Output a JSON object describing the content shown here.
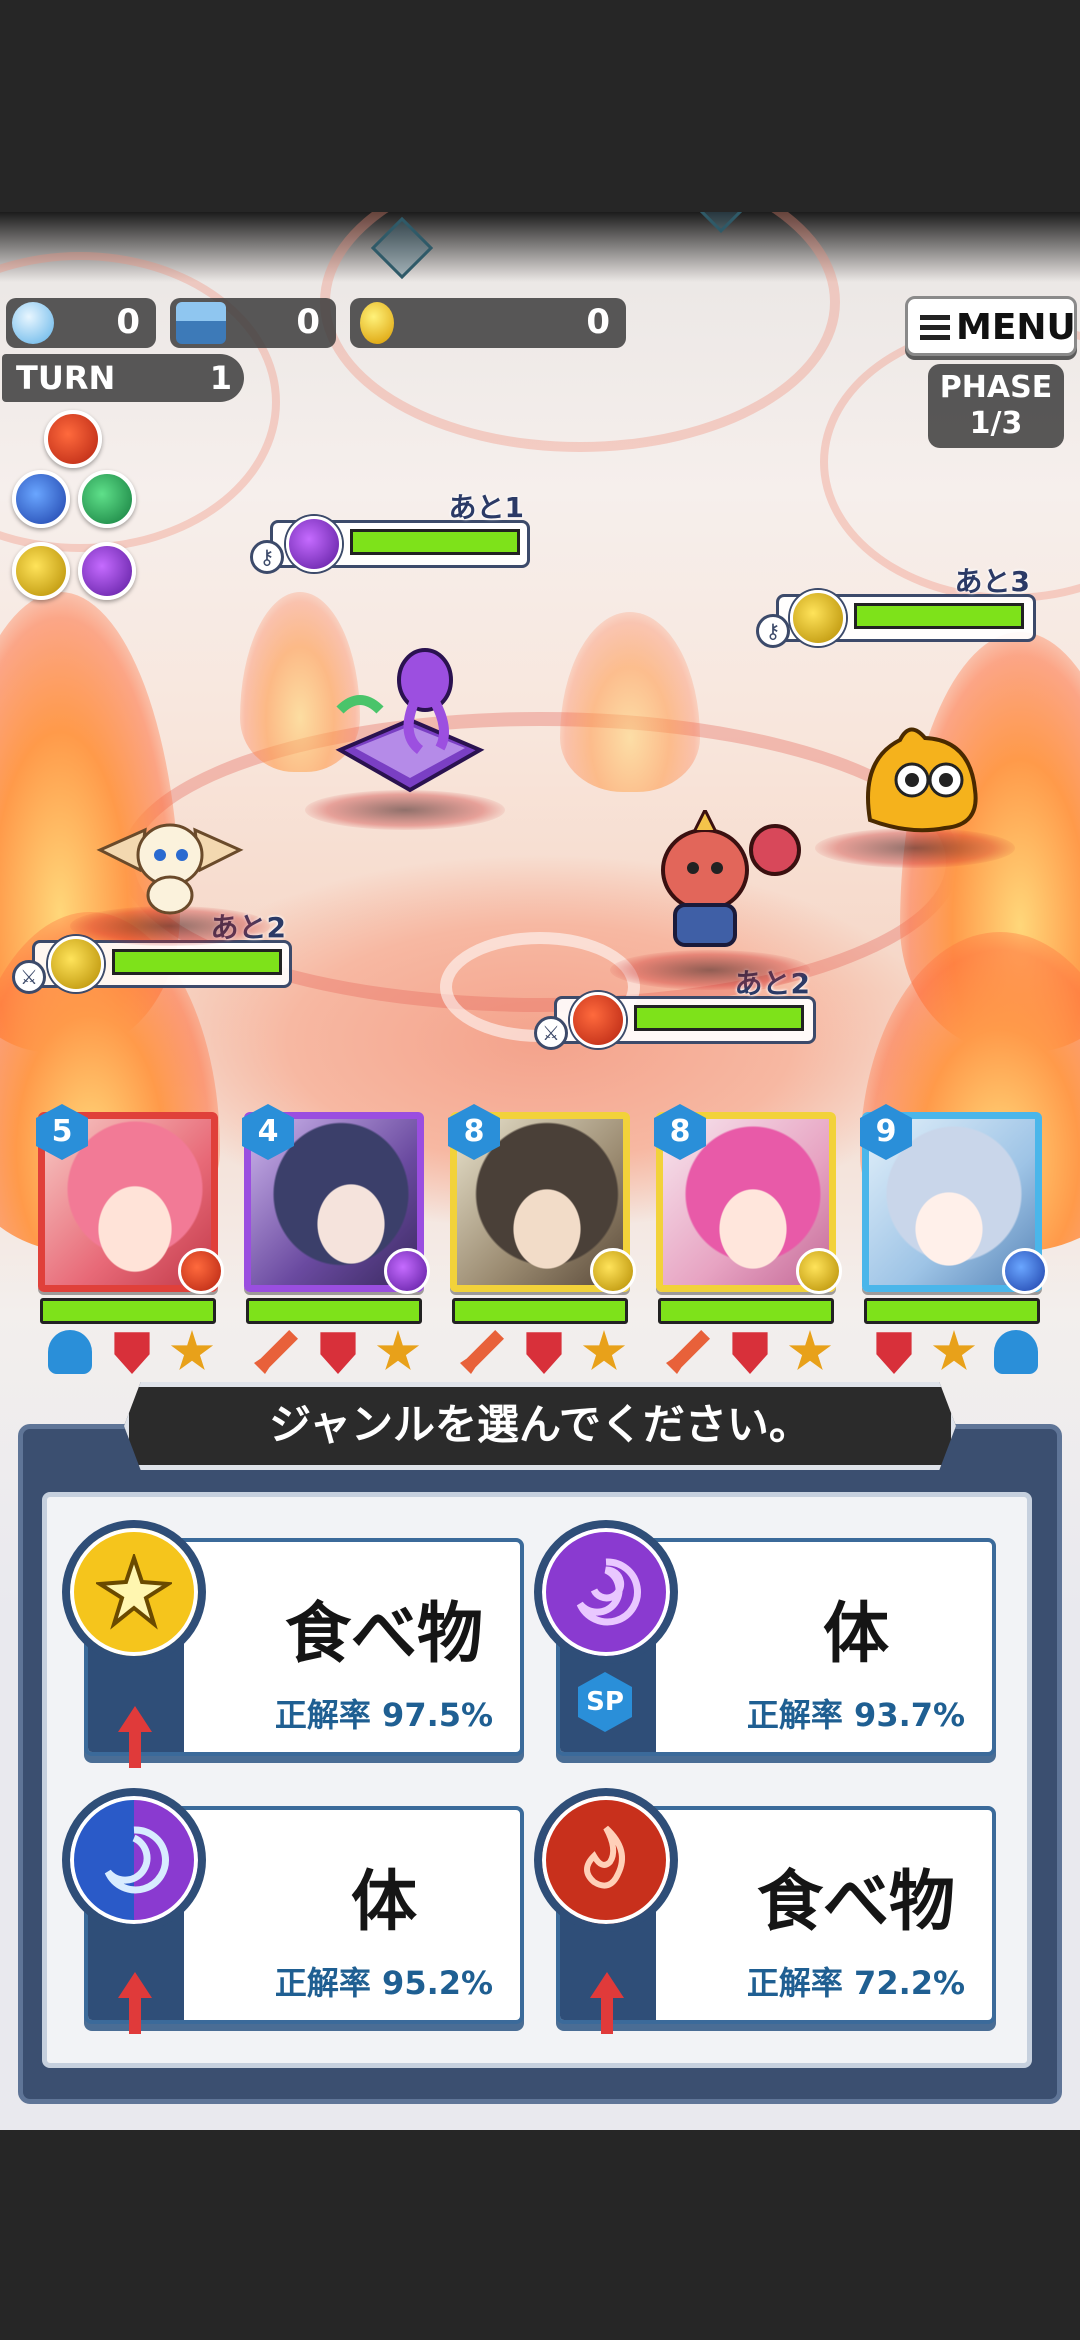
{
  "hud": {
    "counters": [
      {
        "name": "blue-orb-counter",
        "value": "0"
      },
      {
        "name": "chest-counter",
        "value": "0"
      },
      {
        "name": "coin-counter",
        "value": "0"
      }
    ],
    "turn_label": "TURN",
    "turn_value": "1",
    "menu_label": "MENU",
    "phase_label": "PHASE",
    "phase_value": "1/3"
  },
  "element_wheel": [
    "fire-icon",
    "water-icon",
    "wood-icon",
    "light-icon",
    "dark-icon"
  ],
  "enemies": [
    {
      "name": "dark-book-monster",
      "element": "dark",
      "countdown": "あと1",
      "hp": 1.0
    },
    {
      "name": "light-blob-monster",
      "element": "light",
      "countdown": "あと3",
      "hp": 1.0
    },
    {
      "name": "light-dragon-monster",
      "element": "light",
      "countdown": "あと2",
      "hp": 1.0
    },
    {
      "name": "fire-goblin-monster",
      "element": "fire",
      "countdown": "あと2",
      "hp": 1.0
    }
  ],
  "party": [
    {
      "level": "5",
      "element": "fire",
      "color": "#e0403a",
      "hp": 1.0
    },
    {
      "level": "4",
      "element": "dark",
      "color": "#9a4ee0",
      "hp": 1.0
    },
    {
      "level": "8",
      "element": "light",
      "color": "#f2d23a",
      "hp": 1.0
    },
    {
      "level": "8",
      "element": "light",
      "color": "#f2d23a",
      "hp": 1.0
    },
    {
      "level": "9",
      "element": "water",
      "color": "#4ab6ea",
      "hp": 1.0
    }
  ],
  "prompt": "ジャンルを選んでください。",
  "choices": [
    {
      "genre": "食べ物",
      "rate": "正解率 97.5%",
      "element": "light",
      "marker": "up-arrow"
    },
    {
      "genre": "体",
      "rate": "正解率 93.7%",
      "element": "dark",
      "marker": "SP"
    },
    {
      "genre": "体",
      "rate": "正解率 95.2%",
      "element": "water-dark",
      "marker": "up-arrow"
    },
    {
      "genre": "食べ物",
      "rate": "正解率 72.2%",
      "element": "fire",
      "marker": "up-arrow"
    }
  ],
  "colors": {
    "hp_green": "#7ee21a",
    "panel_navy": "#3b4f70",
    "rate_blue": "#1f5f92"
  }
}
